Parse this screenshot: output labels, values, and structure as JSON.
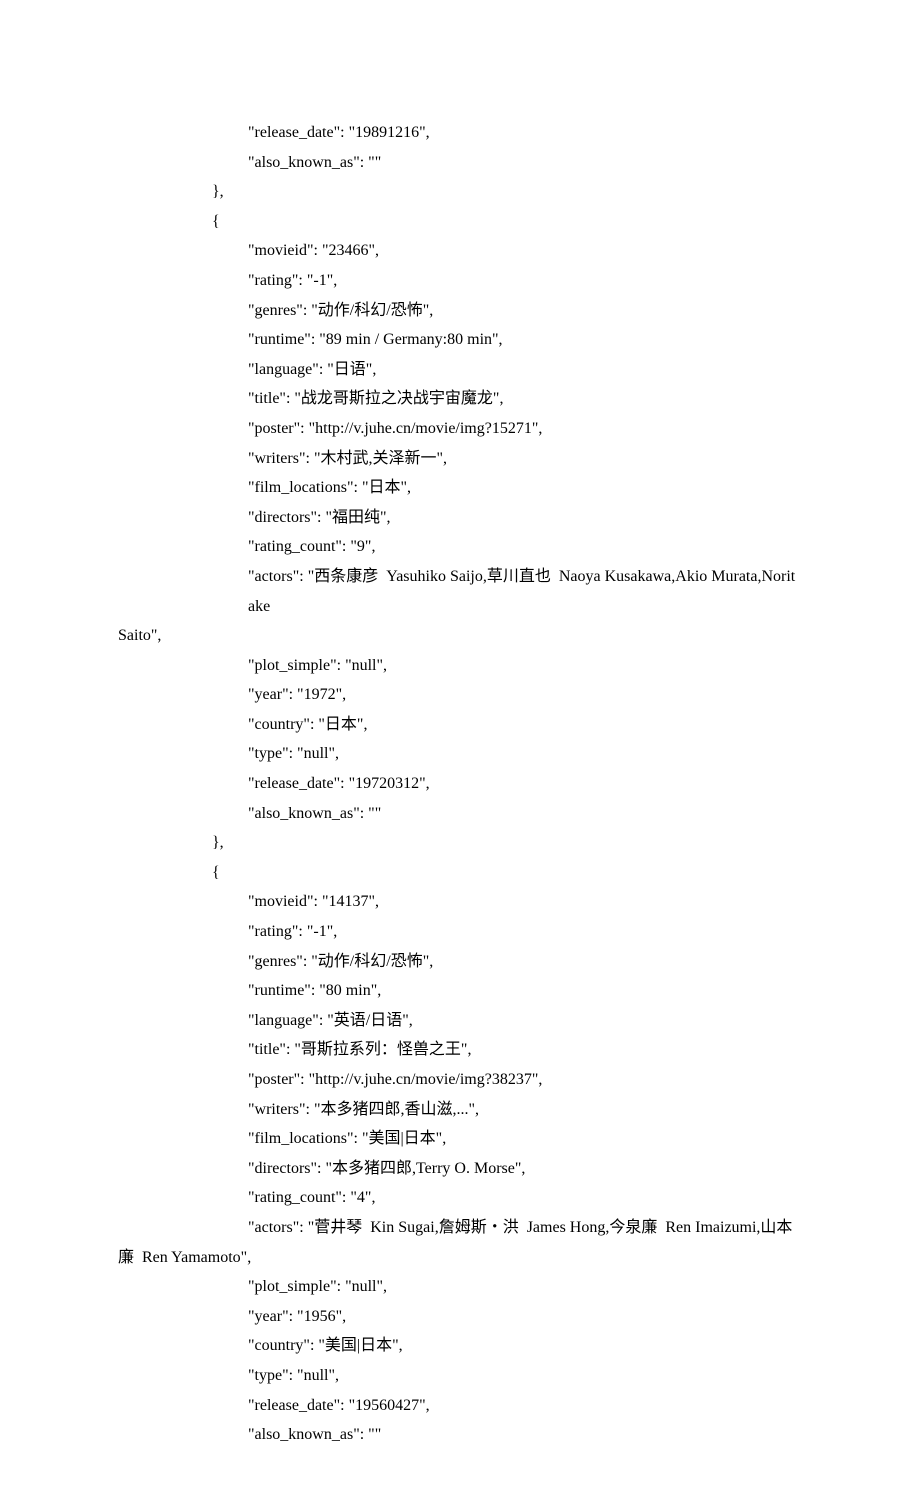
{
  "lines": [
    {
      "ind": 2,
      "text": "\"release_date\": \"19891216\","
    },
    {
      "ind": 2,
      "text": "\"also_known_as\": \"\""
    },
    {
      "ind": 1,
      "text": "},"
    },
    {
      "ind": 1,
      "text": "{"
    },
    {
      "ind": 2,
      "text": "\"movieid\": \"23466\","
    },
    {
      "ind": 2,
      "text": "\"rating\": \"-1\","
    },
    {
      "ind": 2,
      "text": "\"genres\": \"动作/科幻/恐怖\","
    },
    {
      "ind": 2,
      "text": "\"runtime\": \"89 min / Germany:80 min\","
    },
    {
      "ind": 2,
      "text": "\"language\": \"日语\","
    },
    {
      "ind": 2,
      "text": "\"title\": \"战龙哥斯拉之决战宇宙魔龙\","
    },
    {
      "ind": 2,
      "text": "\"poster\": \"http://v.juhe.cn/movie/img?15271\","
    },
    {
      "ind": 2,
      "text": "\"writers\": \"木村武,关泽新一\","
    },
    {
      "ind": 2,
      "text": "\"film_locations\": \"日本\","
    },
    {
      "ind": 2,
      "text": "\"directors\": \"福田纯\","
    },
    {
      "ind": 2,
      "text": "\"rating_count\": \"9\","
    },
    {
      "ind": 2,
      "text": "\"actors\": \"西条康彦  Yasuhiko Saijo,草川直也  Naoya Kusakawa,Akio Murata,Noritake "
    },
    {
      "ind": 0,
      "text": "Saito\","
    },
    {
      "ind": 2,
      "text": "\"plot_simple\": \"null\","
    },
    {
      "ind": 2,
      "text": "\"year\": \"1972\","
    },
    {
      "ind": 2,
      "text": "\"country\": \"日本\","
    },
    {
      "ind": 2,
      "text": "\"type\": \"null\","
    },
    {
      "ind": 2,
      "text": "\"release_date\": \"19720312\","
    },
    {
      "ind": 2,
      "text": "\"also_known_as\": \"\""
    },
    {
      "ind": 1,
      "text": "},"
    },
    {
      "ind": 1,
      "text": "{"
    },
    {
      "ind": 2,
      "text": "\"movieid\": \"14137\","
    },
    {
      "ind": 2,
      "text": "\"rating\": \"-1\","
    },
    {
      "ind": 2,
      "text": "\"genres\": \"动作/科幻/恐怖\","
    },
    {
      "ind": 2,
      "text": "\"runtime\": \"80 min\","
    },
    {
      "ind": 2,
      "text": "\"language\": \"英语/日语\","
    },
    {
      "ind": 2,
      "text": "\"title\": \"哥斯拉系列：怪兽之王\","
    },
    {
      "ind": 2,
      "text": "\"poster\": \"http://v.juhe.cn/movie/img?38237\","
    },
    {
      "ind": 2,
      "text": "\"writers\": \"本多猪四郎,香山滋,...\","
    },
    {
      "ind": 2,
      "text": "\"film_locations\": \"美国|日本\","
    },
    {
      "ind": 2,
      "text": "\"directors\": \"本多猪四郎,Terry O. Morse\","
    },
    {
      "ind": 2,
      "text": "\"rating_count\": \"4\","
    },
    {
      "ind": 2,
      "text": "\"actors\": \"菅井琴  Kin Sugai,詹姆斯・洪  James Hong,今泉廉  Ren Imaizumi,山本"
    },
    {
      "ind": 0,
      "text": "廉  Ren Yamamoto\","
    },
    {
      "ind": 2,
      "text": "\"plot_simple\": \"null\","
    },
    {
      "ind": 2,
      "text": "\"year\": \"1956\","
    },
    {
      "ind": 2,
      "text": "\"country\": \"美国|日本\","
    },
    {
      "ind": 2,
      "text": "\"type\": \"null\","
    },
    {
      "ind": 2,
      "text": "\"release_date\": \"19560427\","
    },
    {
      "ind": 2,
      "text": "\"also_known_as\": \"\""
    }
  ]
}
